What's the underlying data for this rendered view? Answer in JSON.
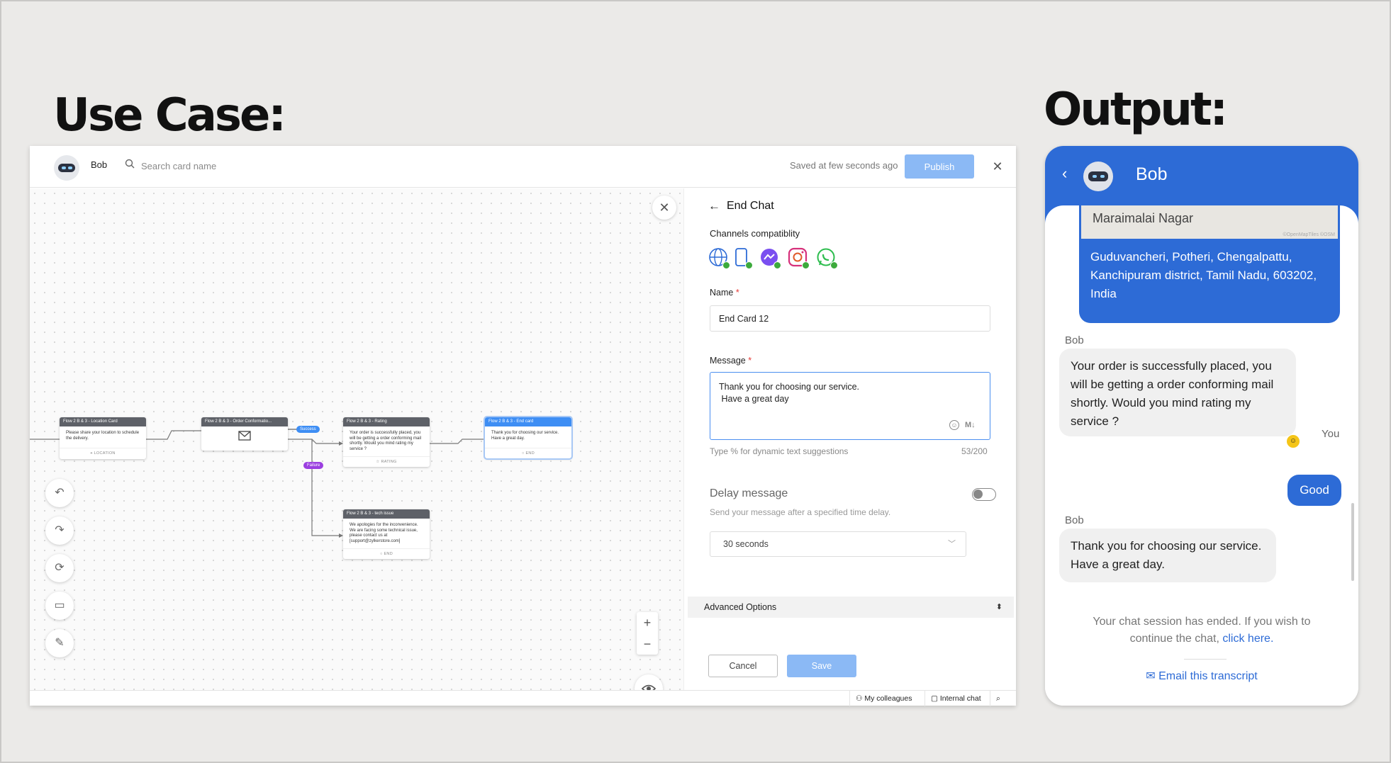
{
  "headings": {
    "use_case": "Use Case:",
    "output": "Output:"
  },
  "topbar": {
    "bot_name": "Bob",
    "search_placeholder": "Search card name",
    "saved_status": "Saved at few seconds ago",
    "publish_label": "Publish"
  },
  "flow": {
    "nodes": [
      {
        "title": "Flow 2 B & 3 - Location Card",
        "body": "Please share your location to schedule the delivery.",
        "footer": "LOCATION"
      },
      {
        "title": "Flow 2 B & 3 - Order Conformatio...",
        "body": "",
        "footer": ""
      },
      {
        "title": "Flow 2 B & 3 - Rating",
        "body": "Your order is successfully placed, you will be getting a order conforming mail shortly. Would you mind rating my service ?",
        "footer": "RATING"
      },
      {
        "title": "Flow 2 B & 3 - End card",
        "body": "Thank you for choosing our service. Have a great day.",
        "footer": "END"
      },
      {
        "title": "Flow 2 B & 3 - tech issue",
        "body": "We apologies for the inconvenience. We are facing some technical issue, please contact us at [support@zylkerstore.com]",
        "footer": "END"
      }
    ],
    "success_label": "Success",
    "failure_label": "Failure"
  },
  "panel": {
    "title": "End Chat",
    "channels_label": "Channels compatiblity",
    "channels": [
      "web-icon",
      "mobile-icon",
      "messenger-icon",
      "instagram-icon",
      "whatsapp-icon"
    ],
    "name_label": "Name",
    "name_value": "End Card 12",
    "message_label": "Message",
    "message_value": "Thank you for choosing our service.\n Have a great day",
    "message_hint": "Type % for dynamic text suggestions",
    "message_count": "53/200",
    "delay_label": "Delay message",
    "delay_sub": "Send your message after a specified time delay.",
    "delay_value": "30 seconds",
    "advanced_label": "Advanced Options",
    "cancel_label": "Cancel",
    "save_label": "Save"
  },
  "statusbar": {
    "colleagues": "My colleagues",
    "internal_chat": "Internal chat"
  },
  "chat": {
    "bot_name": "Bob",
    "map_place": "Maraimalai Nagar",
    "map_credit": "©OpenMapTiles ©OSM",
    "map_address": "Guduvancheri, Potheri, Chengalpattu, Kanchipuram district, Tamil Nadu, 603202, India",
    "sender_bot": "Bob",
    "sender_user": "You",
    "msg_rating": "Your order is successfully placed, you will be getting a order conforming mail shortly. Would you mind rating my service ?",
    "msg_user": "Good",
    "msg_end": "Thank you for choosing our service. Have a great day.",
    "ended_text": "Your chat session has ended. If you wish to continue the chat,",
    "ended_link": "click here.",
    "email_transcript": "Email this transcript"
  },
  "colors": {
    "accent": "#2d6bd6",
    "publish": "#8bb9f5",
    "success": "#3caa3c",
    "failure": "#9b3fe0"
  }
}
